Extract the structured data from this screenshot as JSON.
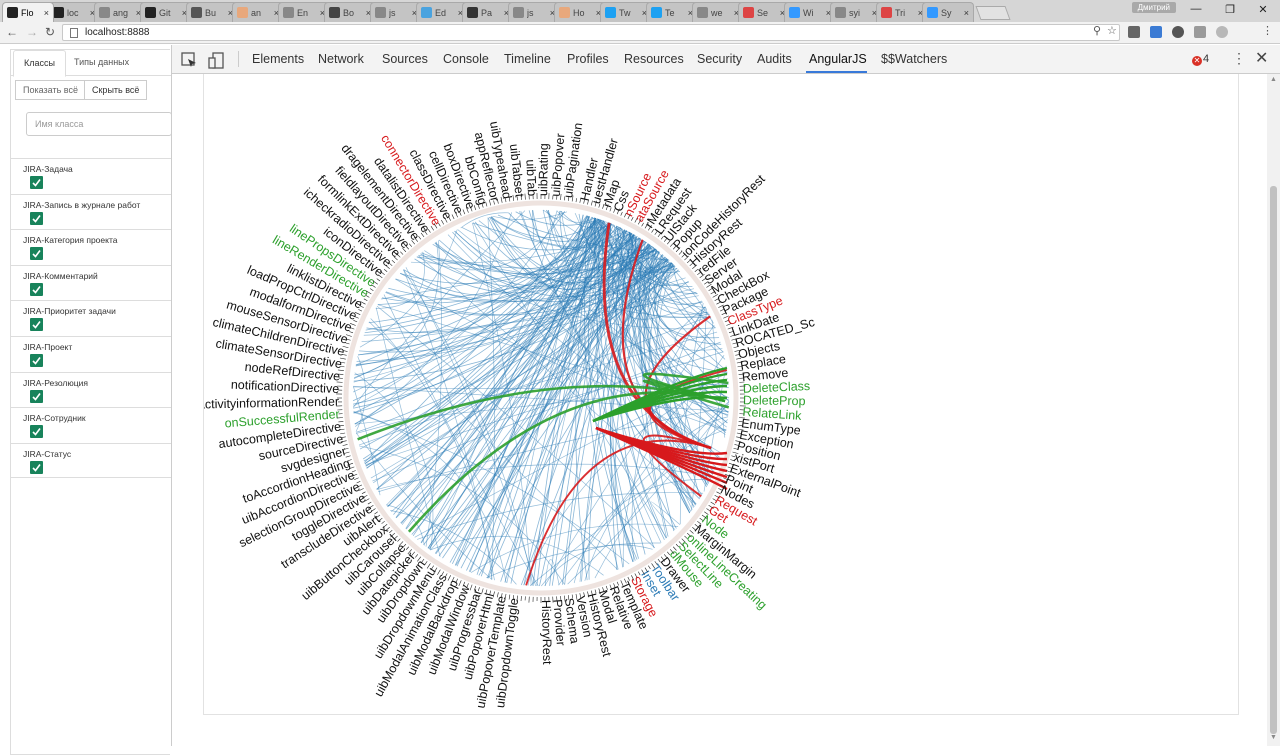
{
  "browser": {
    "tabs": [
      {
        "title": "Flo",
        "color": "#222"
      },
      {
        "title": "loc",
        "color": "#222"
      },
      {
        "title": "ang",
        "color": "#888"
      },
      {
        "title": "Git",
        "color": "#222"
      },
      {
        "title": "Bu",
        "color": "#555"
      },
      {
        "title": "an",
        "color": "#e8a87c"
      },
      {
        "title": "En",
        "color": "#888"
      },
      {
        "title": "Bo",
        "color": "#444"
      },
      {
        "title": "js",
        "color": "#888"
      },
      {
        "title": "Ed",
        "color": "#4aa3df"
      },
      {
        "title": "Pa",
        "color": "#333"
      },
      {
        "title": "js",
        "color": "#888"
      },
      {
        "title": "Ho",
        "color": "#e8a87c"
      },
      {
        "title": "Tw",
        "color": "#1da1f2"
      },
      {
        "title": "Te",
        "color": "#1da1f2"
      },
      {
        "title": "we",
        "color": "#888"
      },
      {
        "title": "Se",
        "color": "#d44"
      },
      {
        "title": "Wi",
        "color": "#39f"
      },
      {
        "title": "syi",
        "color": "#888"
      },
      {
        "title": "Tri",
        "color": "#d44"
      },
      {
        "title": "Sy",
        "color": "#39f"
      }
    ],
    "tab_close": "×",
    "user_badge": "Дмитрий",
    "url": "localhost:8888",
    "minimize": "—",
    "restore": "❐",
    "close": "✕"
  },
  "left_panel": {
    "tab_classes": "Классы",
    "tab_types": "Типы данных",
    "btn_show_all": "Показать всё",
    "btn_hide_all": "Скрыть всё",
    "search_placeholder": "Имя класса",
    "classes": [
      {
        "label": "JIRA-Задача",
        "checked": true
      },
      {
        "label": "JIRA-Запись в журнале работ",
        "checked": true
      },
      {
        "label": "JIRA-Категория проекта",
        "checked": true
      },
      {
        "label": "JIRA-Комментарий",
        "checked": true
      },
      {
        "label": "JIRA-Приоритет задачи",
        "checked": true
      },
      {
        "label": "JIRA-Проект",
        "checked": true
      },
      {
        "label": "JIRA-Резолюция",
        "checked": true
      },
      {
        "label": "JIRA-Сотрудник",
        "checked": true
      },
      {
        "label": "JIRA-Статус",
        "checked": true
      }
    ]
  },
  "devtools": {
    "tabs": [
      "Elements",
      "Network",
      "Sources",
      "Console",
      "Timeline",
      "Profiles",
      "Resources",
      "Security",
      "Audits",
      "AngularJS",
      "$$Watchers"
    ],
    "active_tab": "AngularJS",
    "error_count": "4"
  },
  "chart_data": {
    "type": "hierarchical-edge-bundling",
    "highlight_colors": {
      "default": "#2c7bb6",
      "incoming": "#d7191c",
      "outgoing": "#2ca02c"
    },
    "labels_right": [
      {
        "text": "Handler",
        "color": "#111"
      },
      {
        "text": "uestHandler",
        "color": "#111"
      },
      {
        "text": "rMap",
        "color": "#111"
      },
      {
        "text": "Css",
        "color": "#111"
      },
      {
        "text": "nSource",
        "color": "#d7191c"
      },
      {
        "text": "ataSource",
        "color": "#d7191c"
      },
      {
        "text": "rMetadata",
        "color": "#111"
      },
      {
        "text": "LRequest",
        "color": "#111"
      },
      {
        "text": "UIStack",
        "color": "#111"
      },
      {
        "text": "Popup",
        "color": "#111"
      },
      {
        "text": "ionCodeHistoryRest",
        "color": "#111"
      },
      {
        "text": "HistoryRest",
        "color": "#111"
      },
      {
        "text": "redFile",
        "color": "#111"
      },
      {
        "text": "Server",
        "color": "#111"
      },
      {
        "text": "Modal",
        "color": "#111"
      },
      {
        "text": "CheckBox",
        "color": "#111"
      },
      {
        "text": "Package",
        "color": "#111"
      },
      {
        "text": "ClassType",
        "color": "#d7191c"
      },
      {
        "text": "LinkDate",
        "color": "#111"
      },
      {
        "text": "ROCATED_Sc",
        "color": "#111"
      },
      {
        "text": "Objects",
        "color": "#111"
      },
      {
        "text": "Replace",
        "color": "#111"
      },
      {
        "text": "Remove",
        "color": "#111"
      },
      {
        "text": "DeleteClass",
        "color": "#2ca02c"
      },
      {
        "text": "DeleteProp",
        "color": "#2ca02c"
      },
      {
        "text": "RelateLink",
        "color": "#2ca02c"
      },
      {
        "text": "EnumType",
        "color": "#111"
      },
      {
        "text": "Exception",
        "color": "#111"
      },
      {
        "text": "Position",
        "color": "#111"
      },
      {
        "text": "xistPort",
        "color": "#111"
      },
      {
        "text": "ExternalPoint",
        "color": "#111"
      },
      {
        "text": "Point",
        "color": "#111"
      },
      {
        "text": "Nodes",
        "color": "#111"
      },
      {
        "text": "Request",
        "color": "#d7191c"
      },
      {
        "text": "Get",
        "color": "#d7191c"
      },
      {
        "text": "Node",
        "color": "#2ca02c"
      },
      {
        "text": "MarginMargin",
        "color": "#111"
      },
      {
        "text": "onlineLineCreating",
        "color": "#2ca02c"
      },
      {
        "text": "SelectLine",
        "color": "#2ca02c"
      },
      {
        "text": "dMouse",
        "color": "#2ca02c"
      },
      {
        "text": "Drawer",
        "color": "#111"
      },
      {
        "text": "Toolbar",
        "color": "#2c7bb6"
      },
      {
        "text": "Inset",
        "color": "#2c7bb6"
      },
      {
        "text": "Storage",
        "color": "#d7191c"
      },
      {
        "text": "Template",
        "color": "#111"
      },
      {
        "text": "Relative",
        "color": "#111"
      },
      {
        "text": "Modal",
        "color": "#111"
      },
      {
        "text": "HistoryRest",
        "color": "#111"
      },
      {
        "text": "Version",
        "color": "#111"
      },
      {
        "text": "Schema",
        "color": "#111"
      },
      {
        "text": "Provider",
        "color": "#111"
      },
      {
        "text": "HistoryRest",
        "color": "#111"
      }
    ],
    "labels_left": [
      {
        "text": "uibDropdownToggle",
        "color": "#111"
      },
      {
        "text": "uibPopoverTemplate",
        "color": "#111"
      },
      {
        "text": "uibPopoverHtml",
        "color": "#111"
      },
      {
        "text": "uibProgressbar",
        "color": "#111"
      },
      {
        "text": "uibModalWindow",
        "color": "#111"
      },
      {
        "text": "uibModalBackdrop",
        "color": "#111"
      },
      {
        "text": "uibModalAnimationClass",
        "color": "#111"
      },
      {
        "text": "uibDropdownMenu",
        "color": "#111"
      },
      {
        "text": "uibDropdown",
        "color": "#111"
      },
      {
        "text": "uibDatepicker",
        "color": "#111"
      },
      {
        "text": "uibCollapse",
        "color": "#111"
      },
      {
        "text": "uibCarousel",
        "color": "#111"
      },
      {
        "text": "uibButtonCheckbox",
        "color": "#111"
      },
      {
        "text": "uibAlert",
        "color": "#111"
      },
      {
        "text": "transcludeDirective",
        "color": "#111"
      },
      {
        "text": "toggleDirective",
        "color": "#111"
      },
      {
        "text": "selectionGroupDirective",
        "color": "#111"
      },
      {
        "text": "uibAccordionDirective",
        "color": "#111"
      },
      {
        "text": "toAccordionHeading",
        "color": "#111"
      },
      {
        "text": "svgdesigner",
        "color": "#111"
      },
      {
        "text": "sourceDirective",
        "color": "#111"
      },
      {
        "text": "autocompleteDirective",
        "color": "#111"
      },
      {
        "text": "onSuccessfulRender",
        "color": "#2ca02c"
      },
      {
        "text": "activityinformationRender",
        "color": "#111"
      },
      {
        "text": "notificationDirective",
        "color": "#111"
      },
      {
        "text": "nodeRefDirective",
        "color": "#111"
      },
      {
        "text": "climateSensorDirective",
        "color": "#111"
      },
      {
        "text": "climateChildrenDirective",
        "color": "#111"
      },
      {
        "text": "mouseSensorDirective",
        "color": "#111"
      },
      {
        "text": "modalformDirective",
        "color": "#111"
      },
      {
        "text": "loadPropCtrlDirective",
        "color": "#111"
      },
      {
        "text": "linklistDirective",
        "color": "#111"
      },
      {
        "text": "lineRenderDirective",
        "color": "#2ca02c"
      },
      {
        "text": "linePropsDirective",
        "color": "#2ca02c"
      },
      {
        "text": "iconDirective",
        "color": "#111"
      },
      {
        "text": "icheckradioDirective",
        "color": "#111"
      },
      {
        "text": "formlinkExtDirective",
        "color": "#111"
      },
      {
        "text": "fieldlayoutDirective",
        "color": "#111"
      },
      {
        "text": "dragelementDirective",
        "color": "#111"
      },
      {
        "text": "datalistDirective",
        "color": "#111"
      },
      {
        "text": "connectorDirective",
        "color": "#d7191c"
      },
      {
        "text": "classDirective",
        "color": "#111"
      },
      {
        "text": "cellDirective",
        "color": "#111"
      },
      {
        "text": "boxDirective",
        "color": "#111"
      },
      {
        "text": "bbConfig",
        "color": "#111"
      },
      {
        "text": "appReflector",
        "color": "#111"
      },
      {
        "text": "uibTypeahead",
        "color": "#111"
      },
      {
        "text": "uibTabset",
        "color": "#111"
      },
      {
        "text": "uibTab",
        "color": "#111"
      },
      {
        "text": "uibRating",
        "color": "#111"
      },
      {
        "text": "uibPopover",
        "color": "#111"
      },
      {
        "text": "uibPagination",
        "color": "#111"
      }
    ]
  }
}
